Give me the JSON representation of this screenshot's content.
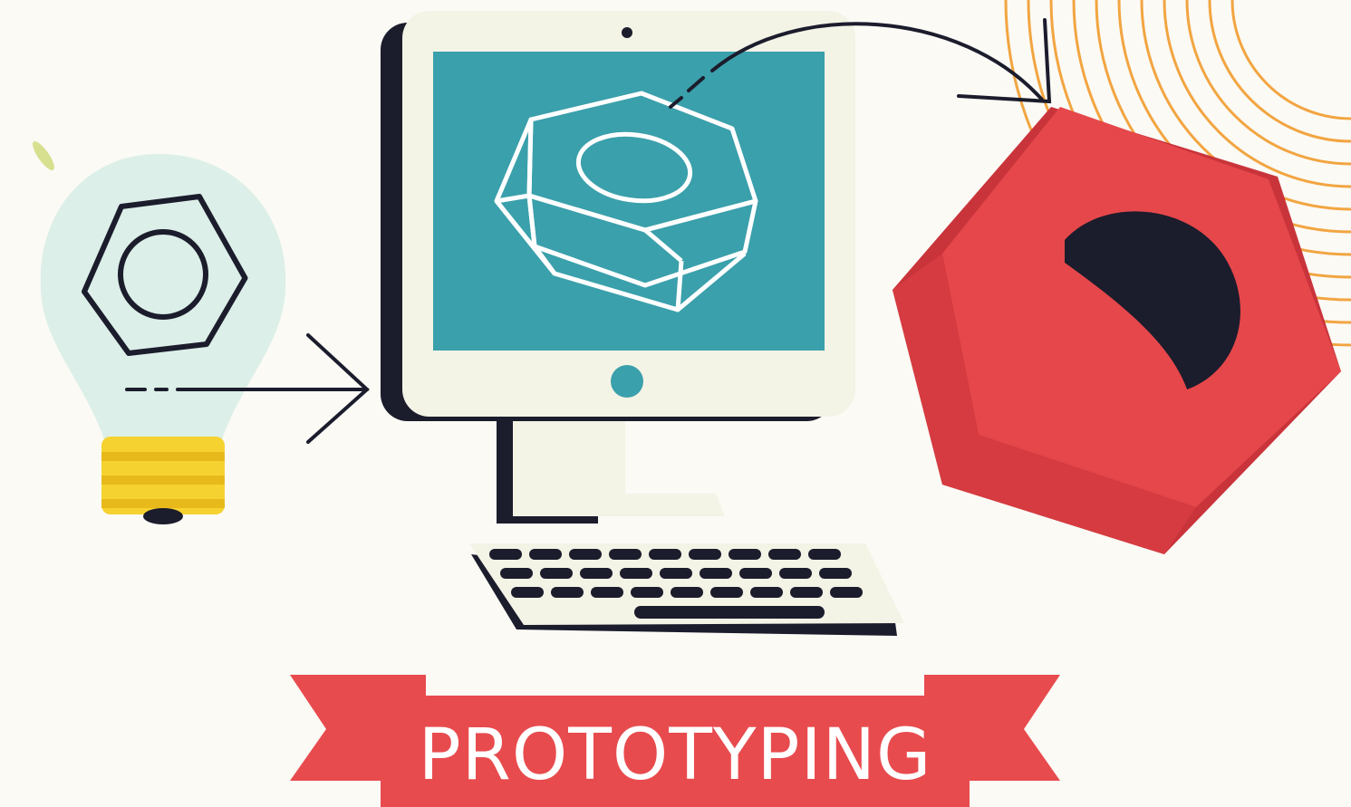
{
  "banner": {
    "label": "PROTOTYPING"
  },
  "steps": [
    {
      "icon": "lightbulb-icon"
    },
    {
      "icon": "computer-icon"
    },
    {
      "icon": "hex-nut-icon"
    }
  ],
  "colors": {
    "background": "#fbfaf5",
    "screen_teal": "#3aa0ab",
    "bulb_glass": "#dcefe8",
    "bulb_base": "#f6d230",
    "nut_red": "#e5474a",
    "nut_red_dark": "#c9343b",
    "banner_red": "#e84b4e",
    "banner_red_dark": "#c73440",
    "outline_dark": "#1b1c2c",
    "accent_orange": "#f2a541"
  }
}
